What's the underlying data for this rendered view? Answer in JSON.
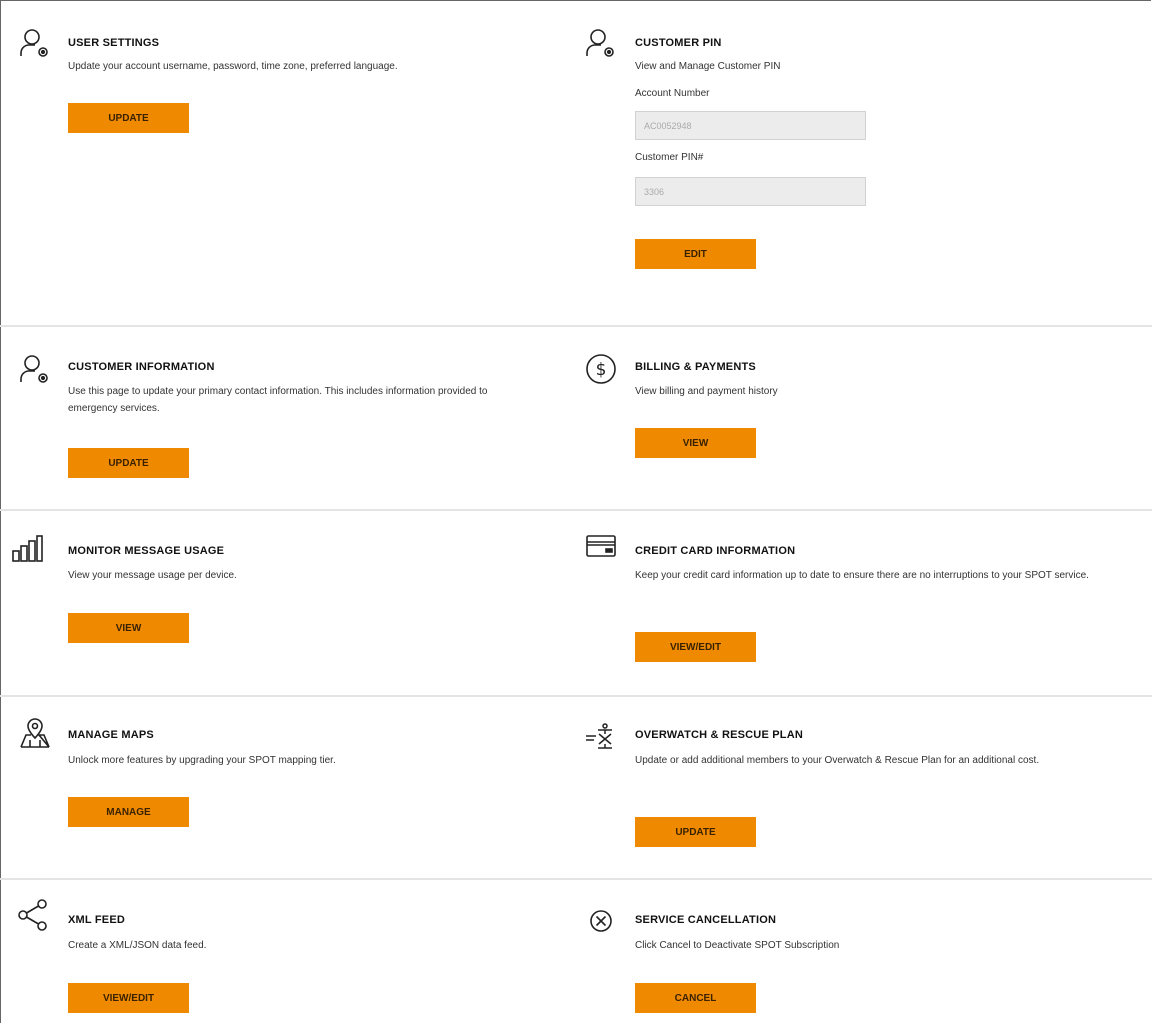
{
  "sections": {
    "user_settings": {
      "title": "USER SETTINGS",
      "description": "Update your account username, password, time zone, preferred language.",
      "button": "UPDATE",
      "icon": "user-gear-icon"
    },
    "customer_pin": {
      "title": "CUSTOMER PIN",
      "description": "View and Manage Customer PIN",
      "account_label": "Account Number",
      "account_value": "AC0052948",
      "pin_label": "Customer PIN#",
      "pin_value": "3306",
      "button": "EDIT",
      "icon": "user-gear-icon"
    },
    "customer_information": {
      "title": "CUSTOMER INFORMATION",
      "description": "Use this page to update your primary contact information. This includes information provided to emergency services.",
      "button": "UPDATE",
      "icon": "user-gear-icon"
    },
    "billing": {
      "title": "BILLING & PAYMENTS",
      "description": "View billing and payment history",
      "button": "VIEW",
      "icon": "dollar-circle-icon"
    },
    "monitor_usage": {
      "title": "MONITOR MESSAGE USAGE",
      "description": "View your message usage per device.",
      "button": "VIEW",
      "icon": "bar-chart-icon"
    },
    "credit_card": {
      "title": "CREDIT CARD INFORMATION",
      "description": "Keep your credit card information up to date to ensure there are no interruptions to your SPOT service.",
      "button": "VIEW/EDIT",
      "icon": "credit-card-icon"
    },
    "manage_maps": {
      "title": "MANAGE MAPS",
      "description": "Unlock more features by upgrading your SPOT mapping tier.",
      "button": "MANAGE",
      "icon": "map-pin-icon"
    },
    "overwatch": {
      "title": "OVERWATCH & RESCUE PLAN",
      "description": "Update or add additional members to your Overwatch & Rescue Plan for an additional cost.",
      "button": "UPDATE",
      "icon": "overwatch-icon"
    },
    "xml_feed": {
      "title": "XML FEED",
      "description": "Create a XML/JSON data feed.",
      "button": "VIEW/EDIT",
      "icon": "share-icon"
    },
    "cancellation": {
      "title": "SERVICE CANCELLATION",
      "description": "Click Cancel to Deactivate SPOT Subscription",
      "button": "CANCEL",
      "icon": "close-circle-icon"
    }
  },
  "colors": {
    "button": "#ef8a00",
    "divider": "#e4e4e4"
  }
}
